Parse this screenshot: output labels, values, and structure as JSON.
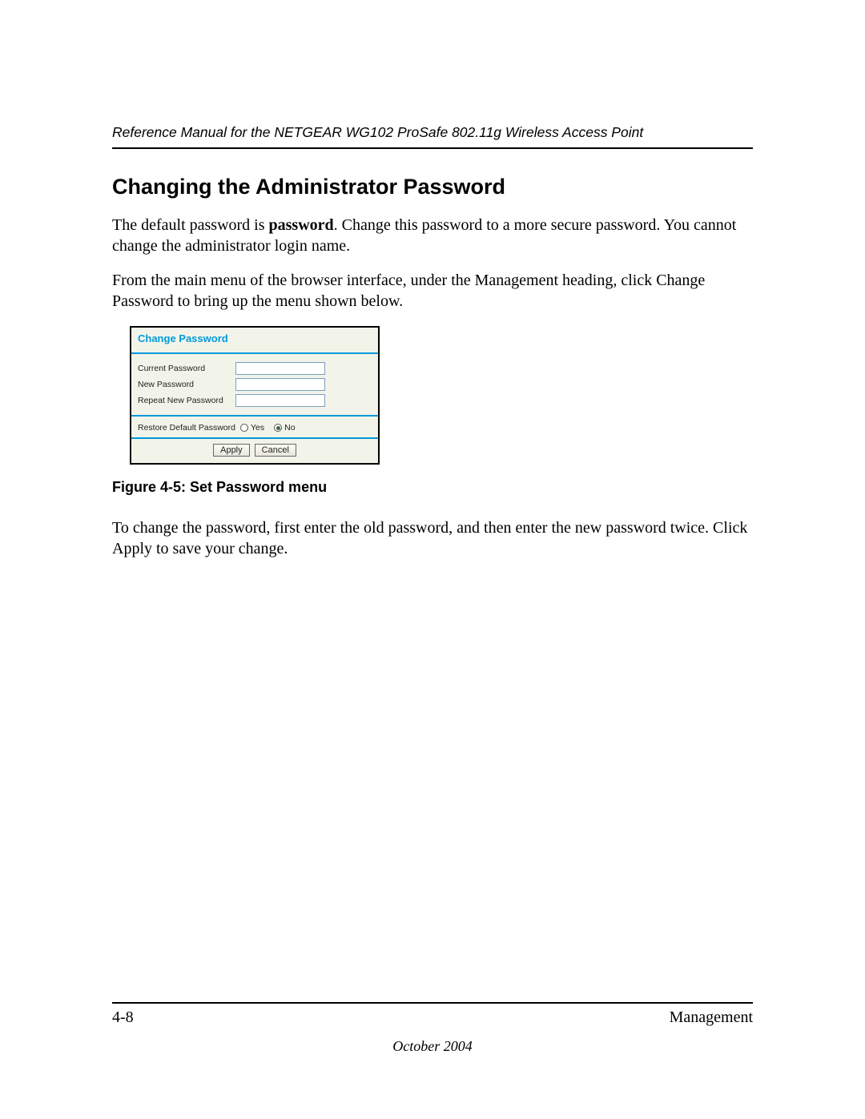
{
  "header": {
    "running_title": "Reference Manual for the NETGEAR WG102 ProSafe 802.11g Wireless Access Point"
  },
  "section": {
    "title": "Changing the Administrator Password",
    "para1_a": "The default password is ",
    "para1_bold": "password",
    "para1_b": ". Change this password to a more secure password. You cannot change the administrator login name.",
    "para2": "From the main menu of the browser interface, under the Management heading, click Change Password to bring up the menu shown below.",
    "para3": "To change the password, first enter the old password, and then enter the new password twice. Click Apply to save your change."
  },
  "figure": {
    "panel_title": "Change Password",
    "current_password_label": "Current Password",
    "new_password_label": "New Password",
    "repeat_new_password_label": "Repeat New Password",
    "restore_label": "Restore Default Password",
    "yes_label": "Yes",
    "no_label": "No",
    "apply_label": "Apply",
    "cancel_label": "Cancel",
    "caption": "Figure 4-5:  Set Password menu"
  },
  "footer": {
    "page_number": "4-8",
    "section_name": "Management",
    "date": "October 2004"
  }
}
